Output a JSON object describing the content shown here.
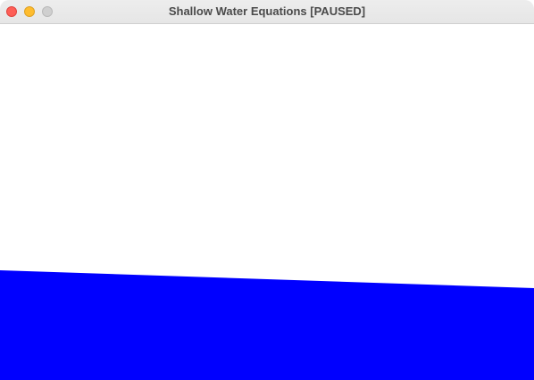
{
  "window": {
    "title": "Shallow Water Equations [PAUSED]",
    "buttons": {
      "close": "close-icon",
      "minimize": "minimize-icon",
      "zoom": "zoom-icon"
    }
  },
  "colors": {
    "background": "#ffffff",
    "water": "#0000ff",
    "close": "#fe5f57",
    "minimize": "#febc2e",
    "zoom": "#cfcfcf"
  }
}
